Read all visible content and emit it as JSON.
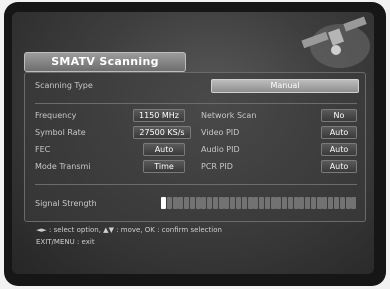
{
  "menu": {
    "title": "SMATV Scanning"
  },
  "scanning_type": {
    "label": "Scanning Type",
    "value": "Manual"
  },
  "fields_left": [
    {
      "label": "Frequency",
      "value": "1150 MHz"
    },
    {
      "label": "Symbol Rate",
      "value": "27500 KS/s"
    },
    {
      "label": "FEC",
      "value": "Auto"
    },
    {
      "label": "Mode Transmi",
      "value": "Time"
    }
  ],
  "fields_right": [
    {
      "label": "Network Scan",
      "value": "No"
    },
    {
      "label": "Video PID",
      "value": "Auto"
    },
    {
      "label": "Audio PID",
      "value": "Auto"
    },
    {
      "label": "PCR PID",
      "value": "Auto"
    }
  ],
  "signal": {
    "label": "Signal Strength",
    "level_fraction": 0.03,
    "segments": 34
  },
  "help": {
    "line1": "◄► : select option, ▲▼ : move, OK : confirm selection",
    "line2": "EXIT/MENU : exit"
  },
  "colors": {
    "title_bar": "#8a8a8a",
    "scan_type_box": "#a8a8a8",
    "text": "#ffffff"
  }
}
